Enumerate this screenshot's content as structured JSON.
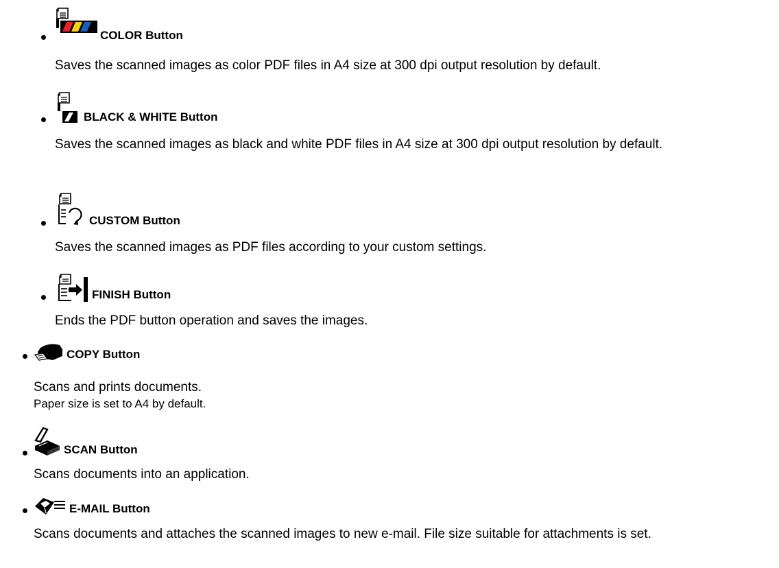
{
  "items": [
    {
      "label": "COLOR Button",
      "desc": [
        "Saves the scanned images as color PDF files in A4 size at 300 dpi output resolution by default."
      ],
      "icon": "pdf-color-icon"
    },
    {
      "label": "BLACK & WHITE Button",
      "desc": [
        "Saves the scanned images as black and white PDF files in A4 size at 300 dpi output resolution by default."
      ],
      "icon": "pdf-black-white-icon"
    },
    {
      "label": "CUSTOM Button",
      "desc": [
        "Saves the scanned images as PDF files according to your custom settings."
      ],
      "icon": "pdf-custom-icon"
    },
    {
      "label": "FINISH Button",
      "desc": [
        "Ends the PDF button operation and saves the images."
      ],
      "icon": "pdf-finish-icon"
    },
    {
      "label": "COPY Button",
      "desc": [
        "Scans and prints documents.",
        "Paper size is set to A4 by default."
      ],
      "icon": "copy-icon"
    },
    {
      "label": "SCAN Button",
      "desc": [
        "Scans documents into an application."
      ],
      "icon": "scan-icon"
    },
    {
      "label": "E-MAIL Button",
      "desc": [
        "Scans documents and attaches the scanned images to new e-mail. File size suitable for attachments is set."
      ],
      "icon": "email-icon"
    }
  ],
  "icon_colors": {
    "red": "#e8202a",
    "yellow": "#f6d10f",
    "blue": "#1560b8"
  }
}
